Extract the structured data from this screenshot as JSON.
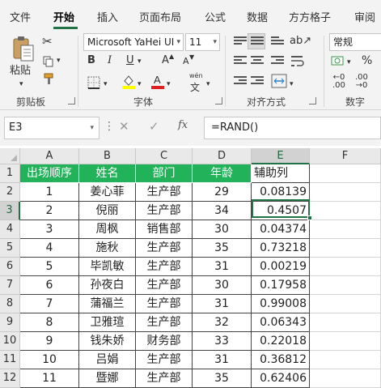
{
  "menu": {
    "tabs": [
      "文件",
      "开始",
      "插入",
      "页面布局",
      "公式",
      "数据",
      "方方格子",
      "审阅"
    ],
    "active": "开始"
  },
  "ribbon": {
    "clipboard": {
      "group_label": "剪贴板",
      "paste_label": "粘贴"
    },
    "font": {
      "group_label": "字体",
      "font_name": "Microsoft YaHei UI",
      "font_size": "11",
      "bold": "B",
      "italic": "I",
      "underline": "U",
      "grow": "A",
      "shrink": "A",
      "wen": "wén",
      "wen_char": "文"
    },
    "alignment": {
      "group_label": "对齐方式"
    },
    "number": {
      "group_label": "数字",
      "format": "常规"
    }
  },
  "formula_bar": {
    "name_box": "E3",
    "fx": "fx",
    "formula": "=RAND()"
  },
  "grid": {
    "columns": [
      "A",
      "B",
      "C",
      "D",
      "E",
      "F"
    ],
    "rows": [
      "1",
      "2",
      "3",
      "4",
      "5",
      "6",
      "7",
      "8",
      "9",
      "10",
      "11",
      "12"
    ],
    "selected_column": "E",
    "selected_row": "3",
    "headers": [
      "出场顺序",
      "姓名",
      "部门",
      "年龄",
      "辅助列"
    ],
    "data": [
      [
        "1",
        "姜心菲",
        "生产部",
        "29",
        "0.08139"
      ],
      [
        "2",
        "倪丽",
        "生产部",
        "34",
        "0.4507"
      ],
      [
        "3",
        "周枫",
        "销售部",
        "30",
        "0.04374"
      ],
      [
        "4",
        "施秋",
        "生产部",
        "35",
        "0.73218"
      ],
      [
        "5",
        "毕凯敏",
        "生产部",
        "31",
        "0.00219"
      ],
      [
        "6",
        "孙夜白",
        "生产部",
        "30",
        "0.17958"
      ],
      [
        "7",
        "蒲福兰",
        "生产部",
        "31",
        "0.99008"
      ],
      [
        "8",
        "卫雅瑄",
        "生产部",
        "32",
        "0.06343"
      ],
      [
        "9",
        "钱朱娇",
        "财务部",
        "33",
        "0.22018"
      ],
      [
        "10",
        "吕娟",
        "生产部",
        "31",
        "0.36812"
      ],
      [
        "11",
        "暨娜",
        "生产部",
        "35",
        "0.62406"
      ]
    ]
  },
  "colors": {
    "header_fill": "#22b25a",
    "accent": "#217346"
  }
}
